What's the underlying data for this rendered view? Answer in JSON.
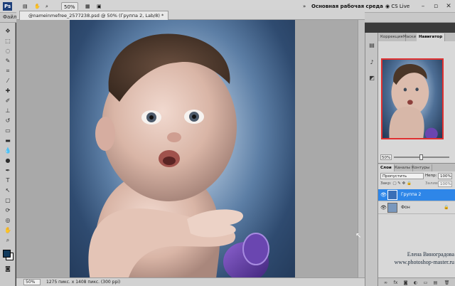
{
  "appbar": {
    "app_icon": "Ps",
    "zoom": "50%",
    "workspace": "Основная рабочая среда",
    "cslive": "CS Live",
    "icons": [
      "mini-bridge-icon",
      "layout-icon",
      "screen-mode-icon",
      "hand-icon",
      "zoom-icon",
      "arrange-icon",
      "extras-icon",
      "minimize-icon",
      "restore-icon",
      "close-icon"
    ]
  },
  "optbar": {
    "menu": "Файл"
  },
  "document": {
    "tab_label": "@nameinmefree_2577238.psd @ 50% (Группа 2, Lab/8) *",
    "status_zoom": "50%",
    "status_info": "1275 пикс. х 1408 пикс. (300 ppi)"
  },
  "panels": {
    "top_tabs": [
      "Коррекция",
      "Маски",
      "Навигатор"
    ],
    "nav_zoom": "50%",
    "layer_tabs": [
      "Слои",
      "Каналы",
      "Контуры"
    ],
    "blend_mode": "Пропустить",
    "opacity_label": "Непр:",
    "opacity": "100%",
    "lock_label": "Закр:",
    "fill_label": "Заливка:",
    "fill": "100%",
    "layers": [
      {
        "name": "Группа 2",
        "selected": true
      },
      {
        "name": "Фон",
        "selected": false
      }
    ]
  },
  "watermark": {
    "line1": "Елена Виноградова",
    "line2": "www.photoshop-master.ru"
  }
}
